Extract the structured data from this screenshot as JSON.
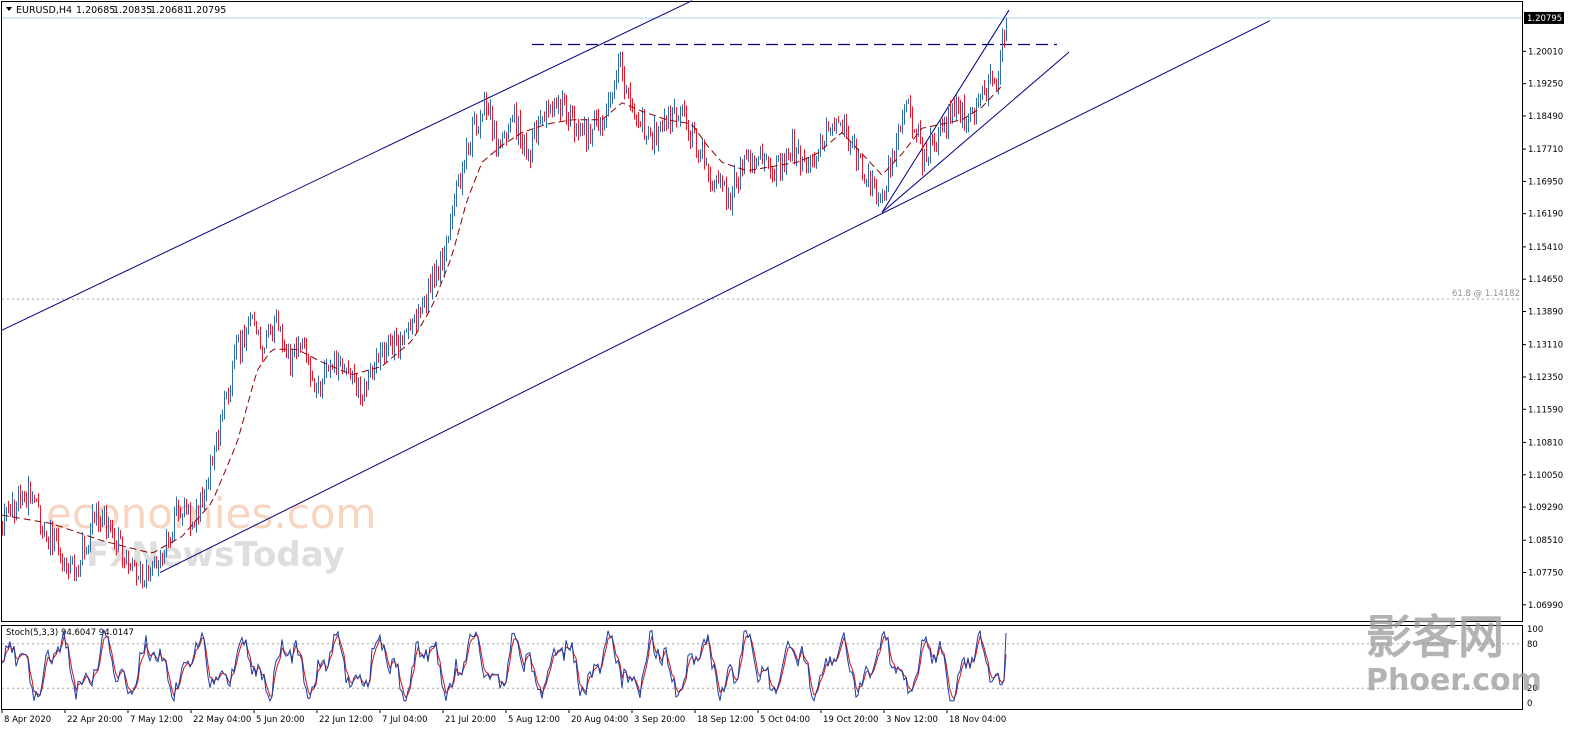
{
  "chart_data": {
    "type": "candlestick",
    "symbol_label": "EURUSD,H4",
    "ohlc_last": [
      "1.20685",
      "1.20835",
      "1.20681",
      "1.20795"
    ],
    "ylim": [
      1.0661,
      1.2117
    ],
    "y_ticks": [
      1.0699,
      1.0775,
      1.0851,
      1.0929,
      1.1005,
      1.1081,
      1.1159,
      1.1235,
      1.1311,
      1.1389,
      1.1465,
      1.1541,
      1.1619,
      1.1695,
      1.1771,
      1.1849,
      1.1925,
      1.2001
    ],
    "y_tick_labels": [
      "1.06990",
      "1.07750",
      "1.08510",
      "1.09290",
      "1.10050",
      "1.10810",
      "1.11590",
      "1.12350",
      "1.13110",
      "1.13890",
      "1.14650",
      "1.15410",
      "1.16190",
      "1.16950",
      "1.17710",
      "1.18490",
      "1.19250",
      "1.20010"
    ],
    "x_range": [
      0,
      1520
    ],
    "x_ticks": [
      0,
      63,
      126,
      189,
      252,
      315,
      378,
      441,
      504,
      567,
      630,
      693,
      756,
      819,
      882,
      945
    ],
    "x_tick_labels": [
      "8 Apr 2020",
      "22 Apr 20:00",
      "7 May 12:00",
      "22 May 04:00",
      "5 Jun 20:00",
      "22 Jun 12:00",
      "7 Jul 04:00",
      "21 Jul 20:00",
      "5 Aug 12:00",
      "20 Aug 04:00",
      "3 Sep 20:00",
      "18 Sep 12:00",
      "5 Oct 04:00",
      "19 Oct 20:00",
      "3 Nov 12:00",
      "18 Nov 04:00"
    ],
    "price_path": [
      [
        0,
        1.089
      ],
      [
        25,
        1.096
      ],
      [
        45,
        1.086
      ],
      [
        72,
        1.078
      ],
      [
        95,
        1.092
      ],
      [
        115,
        1.084
      ],
      [
        135,
        1.077
      ],
      [
        155,
        1.08
      ],
      [
        175,
        1.091
      ],
      [
        195,
        1.091
      ],
      [
        215,
        1.11
      ],
      [
        235,
        1.13
      ],
      [
        250,
        1.136
      ],
      [
        262,
        1.131
      ],
      [
        275,
        1.139
      ],
      [
        285,
        1.128
      ],
      [
        300,
        1.13
      ],
      [
        315,
        1.12
      ],
      [
        330,
        1.127
      ],
      [
        345,
        1.124
      ],
      [
        360,
        1.121
      ],
      [
        380,
        1.129
      ],
      [
        400,
        1.132
      ],
      [
        420,
        1.14
      ],
      [
        440,
        1.151
      ],
      [
        455,
        1.168
      ],
      [
        470,
        1.182
      ],
      [
        485,
        1.188
      ],
      [
        495,
        1.178
      ],
      [
        510,
        1.185
      ],
      [
        525,
        1.176
      ],
      [
        540,
        1.183
      ],
      [
        555,
        1.187
      ],
      [
        565,
        1.186
      ],
      [
        580,
        1.18
      ],
      [
        600,
        1.184
      ],
      [
        618,
        1.197
      ],
      [
        630,
        1.186
      ],
      [
        650,
        1.18
      ],
      [
        665,
        1.185
      ],
      [
        680,
        1.185
      ],
      [
        695,
        1.178
      ],
      [
        710,
        1.17
      ],
      [
        725,
        1.165
      ],
      [
        740,
        1.173
      ],
      [
        760,
        1.176
      ],
      [
        775,
        1.172
      ],
      [
        790,
        1.178
      ],
      [
        805,
        1.171
      ],
      [
        820,
        1.18
      ],
      [
        835,
        1.185
      ],
      [
        850,
        1.178
      ],
      [
        865,
        1.17
      ],
      [
        878,
        1.164
      ],
      [
        890,
        1.175
      ],
      [
        905,
        1.189
      ],
      [
        920,
        1.175
      ],
      [
        935,
        1.18
      ],
      [
        950,
        1.187
      ],
      [
        965,
        1.184
      ],
      [
        980,
        1.189
      ],
      [
        995,
        1.195
      ],
      [
        1005,
        1.208
      ]
    ],
    "moving_average_path": [
      [
        0,
        1.091
      ],
      [
        50,
        1.089
      ],
      [
        100,
        1.085
      ],
      [
        150,
        1.082
      ],
      [
        180,
        1.086
      ],
      [
        210,
        1.094
      ],
      [
        235,
        1.108
      ],
      [
        255,
        1.125
      ],
      [
        270,
        1.13
      ],
      [
        295,
        1.13
      ],
      [
        320,
        1.127
      ],
      [
        350,
        1.124
      ],
      [
        380,
        1.126
      ],
      [
        410,
        1.132
      ],
      [
        430,
        1.14
      ],
      [
        450,
        1.152
      ],
      [
        465,
        1.165
      ],
      [
        480,
        1.174
      ],
      [
        500,
        1.178
      ],
      [
        520,
        1.181
      ],
      [
        545,
        1.183
      ],
      [
        570,
        1.184
      ],
      [
        600,
        1.184
      ],
      [
        620,
        1.188
      ],
      [
        640,
        1.186
      ],
      [
        665,
        1.184
      ],
      [
        690,
        1.183
      ],
      [
        705,
        1.178
      ],
      [
        720,
        1.174
      ],
      [
        745,
        1.172
      ],
      [
        770,
        1.173
      ],
      [
        795,
        1.174
      ],
      [
        815,
        1.176
      ],
      [
        840,
        1.181
      ],
      [
        860,
        1.176
      ],
      [
        880,
        1.171
      ],
      [
        900,
        1.176
      ],
      [
        920,
        1.182
      ],
      [
        940,
        1.183
      ],
      [
        960,
        1.184
      ],
      [
        980,
        1.187
      ],
      [
        1000,
        1.192
      ]
    ],
    "stochastic": {
      "label": "Stoch(5,3,3) 94.6047 94.0147",
      "ylim": [
        0,
        100
      ],
      "y_tick_labels": [
        "100",
        "80",
        "20",
        "0"
      ],
      "levels": [
        80,
        20
      ]
    },
    "horizontal_levels": [
      {
        "price": 1.20795,
        "label": "1.20795"
      },
      {
        "price": 1.14182,
        "label": "61.8 @ 1.14182"
      },
      {
        "price": 1.2017,
        "label": ""
      }
    ],
    "trendlines": [
      {
        "points": [
          [
            0,
            1.1345
          ],
          [
            690,
            1.212
          ]
        ]
      },
      {
        "points": [
          [
            158,
            1.0775
          ],
          [
            1268,
            1.2073
          ]
        ]
      },
      {
        "points": [
          [
            880,
            1.1622
          ],
          [
            1007,
            1.2098
          ]
        ]
      },
      {
        "points": [
          [
            880,
            1.1622
          ],
          [
            1067,
            1.1999
          ]
        ]
      }
    ],
    "colors": {
      "up_candle": "#2e6ca8",
      "down_candle": "#e8192c",
      "trendline": "#000080",
      "moving_average": "#8b0000",
      "stoch_main": "#1e3c9e",
      "stoch_signal": "#d2141e",
      "current_price_line": "#a8d8ec"
    }
  },
  "watermark": {
    "text": "economies.com",
    "subtext": "FxNewsToday"
  },
  "stamp": {
    "text": "影客网",
    "subtext": "Phoer.com"
  }
}
